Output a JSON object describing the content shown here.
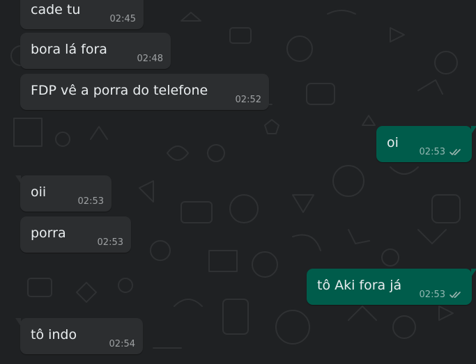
{
  "theme": {
    "background": "#1f2123",
    "incoming_bubble": "#2c2e30",
    "outgoing_bubble": "#005c4b",
    "text": "#e9edef",
    "timestamp": "#9aa0a4"
  },
  "messages": [
    {
      "direction": "incoming",
      "text": "cade tu",
      "time": "02:45"
    },
    {
      "direction": "incoming",
      "text": "bora lá fora",
      "time": "02:48"
    },
    {
      "direction": "incoming",
      "text": "FDP vê a porra do telefone",
      "time": "02:52"
    },
    {
      "direction": "outgoing",
      "text": "oi",
      "time": "02:53",
      "status_icon": "double-check-icon"
    },
    {
      "direction": "incoming",
      "text": "oii",
      "time": "02:53"
    },
    {
      "direction": "incoming",
      "text": "porra",
      "time": "02:53"
    },
    {
      "direction": "outgoing",
      "text": "tô Aki fora já",
      "time": "02:53",
      "status_icon": "double-check-icon"
    },
    {
      "direction": "incoming",
      "text": "tô indo",
      "time": "02:54"
    }
  ]
}
